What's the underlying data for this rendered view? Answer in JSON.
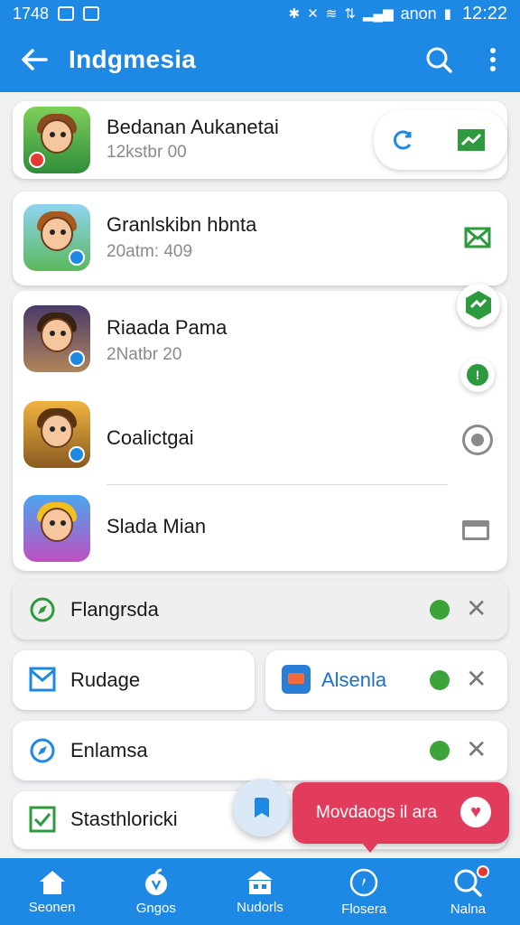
{
  "status_bar": {
    "left_text": "1748",
    "carrier": "anon",
    "time": "12:22"
  },
  "app_bar": {
    "title": "Indgmesia"
  },
  "top_card": {
    "title": "Bedanan Aukanetai",
    "subtitle": "12kstbr 00"
  },
  "list_items": [
    {
      "title": "Granlskibn hbnta",
      "subtitle": "20atm: 409"
    },
    {
      "title": "Riaada Pama",
      "subtitle": "2Natbr 20"
    },
    {
      "title": "Coalictgai",
      "subtitle": ""
    },
    {
      "title": "Slada Mian",
      "subtitle": ""
    }
  ],
  "options": [
    {
      "label": "Flangrsda"
    },
    {
      "label": "Rudage"
    },
    {
      "label": "Alsenla"
    },
    {
      "label": "Enlamsa"
    },
    {
      "label": "Stasthloricki"
    }
  ],
  "toast": {
    "text": "Movdaogs il ara"
  },
  "bottom_nav": [
    {
      "label": "Seonen"
    },
    {
      "label": "Gngos"
    },
    {
      "label": "Nudorls"
    },
    {
      "label": "Flosera"
    },
    {
      "label": "Nalna"
    }
  ],
  "colors": {
    "primary": "#1e88e5",
    "accent_green": "#2e9a3e",
    "toast": "#e23c5d"
  }
}
